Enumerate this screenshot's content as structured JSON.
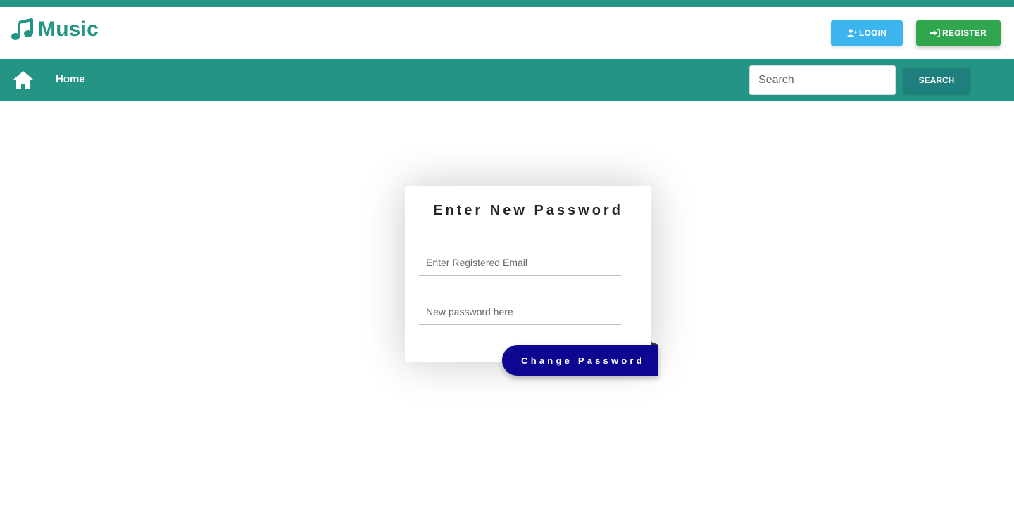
{
  "brand": {
    "name": "Music",
    "icon": "music-note-icon",
    "color": "#249585"
  },
  "header": {
    "login_label": "LOGIN",
    "login_icon": "user-plus-icon",
    "register_label": "REGISTER",
    "register_icon": "sign-in-icon"
  },
  "nav": {
    "home_icon": "home-icon",
    "home_label": "Home",
    "search_placeholder": "Search",
    "search_button_label": "SEARCH"
  },
  "form": {
    "title": "Enter New Password",
    "email_placeholder": "Enter Registered Email",
    "password_placeholder": "New password here",
    "submit_label": "Change Password"
  },
  "colors": {
    "accent": "#249585",
    "login": "#3cb4ee",
    "register": "#30a64f",
    "search_button": "#1f7f7c",
    "submit": "#0c0691"
  }
}
